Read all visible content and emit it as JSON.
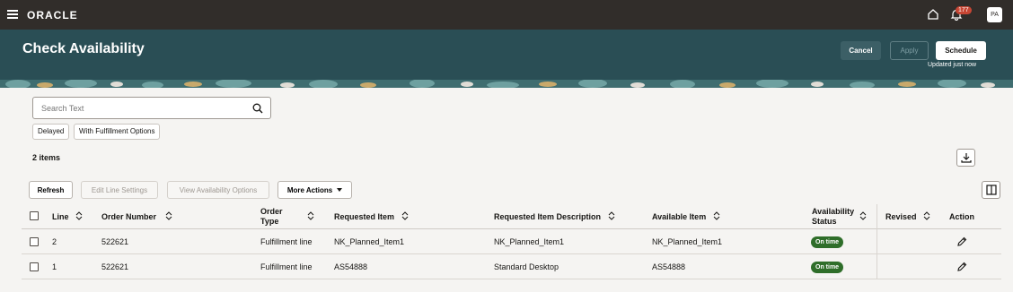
{
  "app": {
    "logo": "ORACLE",
    "notification_count": "177",
    "user_initials": "PA"
  },
  "header": {
    "title": "Check Availability",
    "cancel_label": "Cancel",
    "apply_label": "Apply",
    "schedule_label": "Schedule",
    "updated_text": "Updated just now"
  },
  "search": {
    "placeholder": "Search Text"
  },
  "filters": [
    "Delayed",
    "With Fulfillment Options"
  ],
  "summary": {
    "item_count": "2 items"
  },
  "toolbar": {
    "refresh": "Refresh",
    "edit_line_settings": "Edit Line Settings",
    "view_availability_options": "View Availability Options",
    "more_actions": "More Actions"
  },
  "table": {
    "columns": {
      "line": "Line",
      "order_number": "Order Number",
      "order_type_1": "Order",
      "order_type_2": "Type",
      "requested_item": "Requested Item",
      "requested_item_description": "Requested Item Description",
      "available_item": "Available Item",
      "availability_status_1": "Availability",
      "availability_status_2": "Status",
      "revised": "Revised",
      "action": "Action"
    },
    "rows": [
      {
        "line": "2",
        "order_number": "522621",
        "order_type": "Fulfillment line",
        "requested_item": "NK_Planned_Item1",
        "requested_item_description": "NK_Planned_Item1",
        "available_item": "NK_Planned_Item1",
        "availability_status": "On time"
      },
      {
        "line": "1",
        "order_number": "522621",
        "order_type": "Fulfillment line",
        "requested_item": "AS54888",
        "requested_item_description": "Standard Desktop",
        "available_item": "AS54888",
        "availability_status": "On time"
      }
    ]
  },
  "colors": {
    "topbar": "#312d2a",
    "header": "#2a4e55",
    "status_ok": "#2f6e2a"
  }
}
